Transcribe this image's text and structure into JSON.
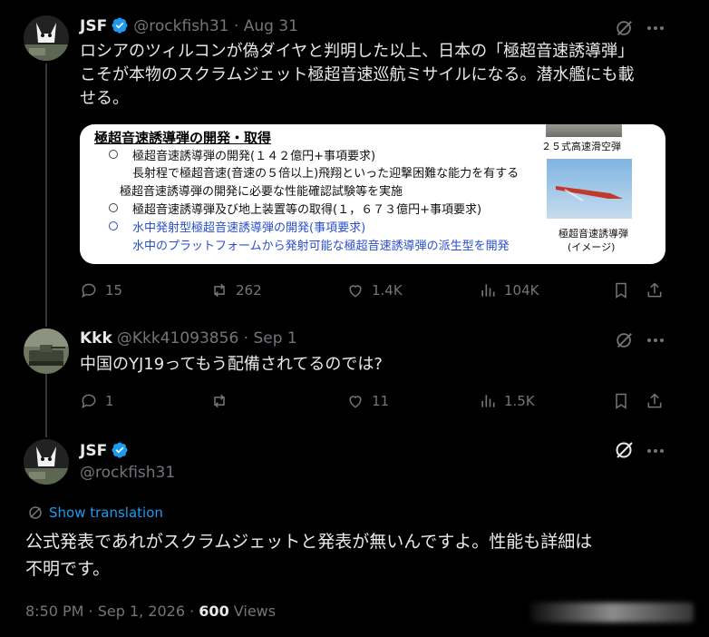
{
  "tweets": [
    {
      "name": "JSF",
      "handle": "@rockfish31",
      "date": "Aug 31",
      "text_line1": "ロシアのツィルコンが偽ダイヤと判明した以上、日本の「極超音速誘導弾」",
      "text_line2": "こそが本物のスクラムジェット極超音速巡航ミサイルになる。潜水艦にも載",
      "text_line3": "せる。",
      "image": {
        "title": "極超音速誘導弾の開発・取得",
        "line1": "極超音速誘導弾の開発(１４２億円+事項要求)",
        "line2": "長射程で極超音速(音速の５倍以上)飛翔といった迎撃困難な能力を有する",
        "line3": "極超音速誘導弾の開発に必要な性能確認試験等を実施",
        "line4": "極超音速誘導弾及び地上装置等の取得(１，６７３億円+事項要求)",
        "line5": "水中発射型極超音速誘導弾の開発(事項要求)",
        "line6": "水中のプラットフォームから発射可能な極超音速誘導弾の派生型を開発",
        "caption1": "２５式高速滑空弾",
        "caption2": "極超音速誘導弾",
        "caption3": "(イメージ)"
      },
      "replies": "15",
      "reposts": "262",
      "likes": "1.4K",
      "views": "104K"
    },
    {
      "name": "Kkk",
      "handle": "@Kkk41093856",
      "date": "Sep 1",
      "text": "中国のYJ19ってもう配備されてるのでは?",
      "replies": "1",
      "likes": "11",
      "views": "1.5K"
    },
    {
      "name": "JSF",
      "handle": "@rockfish31",
      "show_translation": "Show translation",
      "text_line1": "公式発表であれがスクラムジェットと発表が無いんですよ。性能も詳細は",
      "text_line2": "不明です。",
      "time": "8:50 PM · Sep 1, 2026 · ",
      "views_count": "600",
      "views_label": " Views"
    }
  ],
  "colors": {
    "accent": "#1d9bf0",
    "muted": "#71767b",
    "text": "#e7e9ea",
    "link_blue": "#2b4fc9"
  },
  "icons": [
    "grok-icon",
    "more-icon",
    "reply-icon",
    "repost-icon",
    "like-icon",
    "views-icon",
    "bookmark-icon",
    "share-icon",
    "verified-icon",
    "translate-icon"
  ]
}
